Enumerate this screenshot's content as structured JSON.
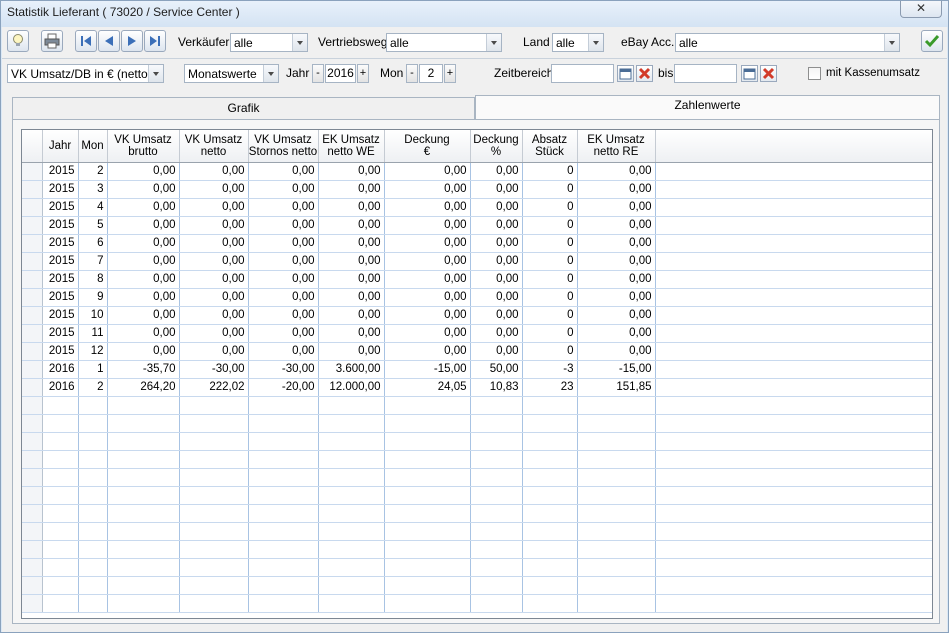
{
  "window": {
    "title": "Statistik Lieferant ( 73020 / Service Center )",
    "close_glyph": "✕"
  },
  "toolbar": {
    "verkaeufer_label": "Verkäufer",
    "verkaeufer_value": "alle",
    "vertriebsweg_label": "Vertriebsweg",
    "vertriebsweg_value": "alle",
    "land_label": "Land",
    "land_value": "alle",
    "ebay_label": "eBay Acc.",
    "ebay_value": "alle",
    "icons": [
      "lightbulb-icon",
      "print-icon",
      "first-icon",
      "prev-icon",
      "next-icon",
      "last-icon",
      "confirm-check-icon"
    ]
  },
  "filters": {
    "measure_value": "VK Umsatz/DB in € (netto)",
    "period_value": "Monatswerte",
    "jahr_label": "Jahr",
    "jahr_value": "2016",
    "mon_label": "Mon",
    "mon_value": "2",
    "minus": "-",
    "plus": "+",
    "zeitbereich_label": "Zeitbereich",
    "zeitbereich_from": "",
    "bis_label": "bis",
    "zeitbereich_to": "",
    "kassen_label": "mit Kassenumsatz",
    "kassen_checked": false
  },
  "tabs": {
    "grafik": "Grafik",
    "zahlenwerte": "Zahlenwerte",
    "active": "zahlenwerte"
  },
  "table": {
    "columns": [
      {
        "line1": "Jahr",
        "line2": ""
      },
      {
        "line1": "Mon",
        "line2": ""
      },
      {
        "line1": "VK Umsatz",
        "line2": "brutto"
      },
      {
        "line1": "VK Umsatz",
        "line2": "netto"
      },
      {
        "line1": "VK Umsatz",
        "line2": "Stornos netto"
      },
      {
        "line1": "EK Umsatz",
        "line2": "netto WE"
      },
      {
        "line1": "Deckung",
        "line2": "€"
      },
      {
        "line1": "Deckung",
        "line2": "%"
      },
      {
        "line1": "Absatz",
        "line2": "Stück"
      },
      {
        "line1": "EK Umsatz",
        "line2": "netto RE"
      }
    ],
    "rows": [
      [
        "2015",
        "2",
        "0,00",
        "0,00",
        "0,00",
        "0,00",
        "0,00",
        "0,00",
        "0",
        "0,00"
      ],
      [
        "2015",
        "3",
        "0,00",
        "0,00",
        "0,00",
        "0,00",
        "0,00",
        "0,00",
        "0",
        "0,00"
      ],
      [
        "2015",
        "4",
        "0,00",
        "0,00",
        "0,00",
        "0,00",
        "0,00",
        "0,00",
        "0",
        "0,00"
      ],
      [
        "2015",
        "5",
        "0,00",
        "0,00",
        "0,00",
        "0,00",
        "0,00",
        "0,00",
        "0",
        "0,00"
      ],
      [
        "2015",
        "6",
        "0,00",
        "0,00",
        "0,00",
        "0,00",
        "0,00",
        "0,00",
        "0",
        "0,00"
      ],
      [
        "2015",
        "7",
        "0,00",
        "0,00",
        "0,00",
        "0,00",
        "0,00",
        "0,00",
        "0",
        "0,00"
      ],
      [
        "2015",
        "8",
        "0,00",
        "0,00",
        "0,00",
        "0,00",
        "0,00",
        "0,00",
        "0",
        "0,00"
      ],
      [
        "2015",
        "9",
        "0,00",
        "0,00",
        "0,00",
        "0,00",
        "0,00",
        "0,00",
        "0",
        "0,00"
      ],
      [
        "2015",
        "10",
        "0,00",
        "0,00",
        "0,00",
        "0,00",
        "0,00",
        "0,00",
        "0",
        "0,00"
      ],
      [
        "2015",
        "11",
        "0,00",
        "0,00",
        "0,00",
        "0,00",
        "0,00",
        "0,00",
        "0",
        "0,00"
      ],
      [
        "2015",
        "12",
        "0,00",
        "0,00",
        "0,00",
        "0,00",
        "0,00",
        "0,00",
        "0",
        "0,00"
      ],
      [
        "2016",
        "1",
        "-35,70",
        "-30,00",
        "-30,00",
        "3.600,00",
        "-15,00",
        "50,00",
        "-3",
        "-15,00"
      ],
      [
        "2016",
        "2",
        "264,20",
        "222,02",
        "-20,00",
        "12.000,00",
        "24,05",
        "10,83",
        "23",
        "151,85"
      ]
    ]
  }
}
